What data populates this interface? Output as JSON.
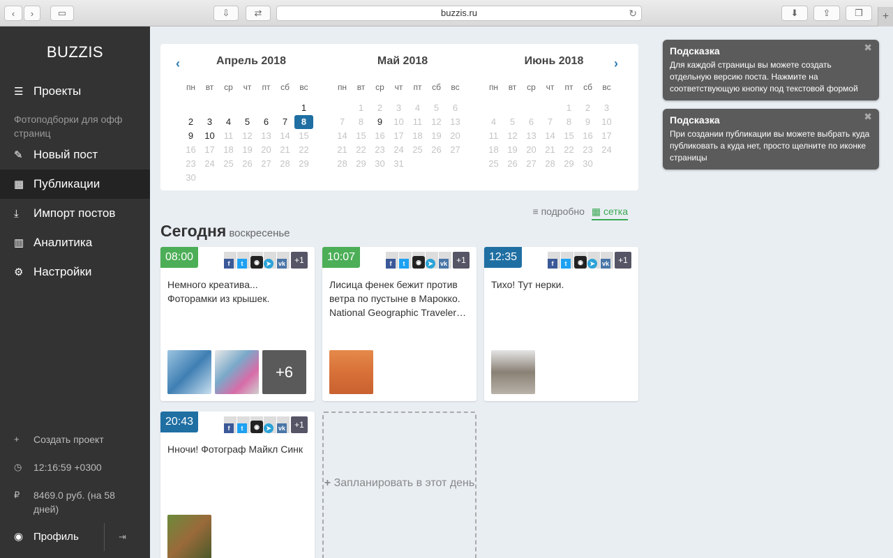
{
  "browser": {
    "url": "buzzis.ru"
  },
  "sidebar": {
    "brand": "BUZZIS",
    "projects": "Проекты",
    "project_name": "Фотоподборки для офф страниц",
    "items": [
      {
        "label": "Новый пост",
        "icon": "pencil-icon"
      },
      {
        "label": "Публикации",
        "icon": "calendar-icon"
      },
      {
        "label": "Импорт постов",
        "icon": "download-icon"
      },
      {
        "label": "Аналитика",
        "icon": "bar-chart-icon"
      },
      {
        "label": "Настройки",
        "icon": "gear-icon"
      }
    ],
    "create_project": "Создать проект",
    "clock": "12:16:59 +0300",
    "balance": "8469.0 руб. (на 58 дней)",
    "profile": "Профиль"
  },
  "calendar": {
    "weekdays": [
      "пн",
      "вт",
      "ср",
      "чт",
      "пт",
      "сб",
      "вс"
    ],
    "months": [
      {
        "title": "Апрель 2018",
        "offset": 6,
        "days": 30,
        "active": [
          1,
          2,
          3,
          4,
          5,
          6,
          7,
          8,
          9,
          10
        ],
        "today": 8
      },
      {
        "title": "Май 2018",
        "offset": 1,
        "days": 31,
        "active": [
          9
        ],
        "today": null
      },
      {
        "title": "Июнь 2018",
        "offset": 4,
        "days": 30,
        "active": [],
        "today": null
      }
    ]
  },
  "view": {
    "detailed": "подробно",
    "grid": "сетка"
  },
  "day": {
    "title": "Сегодня",
    "weekday": "воскресенье"
  },
  "posts": [
    {
      "time": "08:00",
      "color": "#4cae57",
      "text": "Немного креатива... Фоторамки из крышек.",
      "extra_count": "+1",
      "more_photos": "+6"
    },
    {
      "time": "10:07",
      "color": "#4cae57",
      "text": "Лисица фенек бежит против ветра по пустыне в Марокко. National Geographic Traveler…",
      "extra_count": "+1"
    },
    {
      "time": "12:35",
      "color": "#1f6fa3",
      "text": "Тихо! Тут нерки.",
      "extra_count": "+1"
    },
    {
      "time": "20:43",
      "color": "#1f6fa3",
      "text": "Нночи! Фотограф Майкл Синк",
      "extra_count": "+1"
    }
  ],
  "plan_day": "Запланировать в этот день",
  "tips": [
    {
      "title": "Подсказка",
      "text": "Для каждой страницы вы можете создать отдельную версию поста. Нажмите на соответствующую кнопку под текстовой формой"
    },
    {
      "title": "Подсказка",
      "text": "При создании публикации вы можете выбрать куда публиковать а куда нет, просто щелните по иконке страницы"
    }
  ]
}
